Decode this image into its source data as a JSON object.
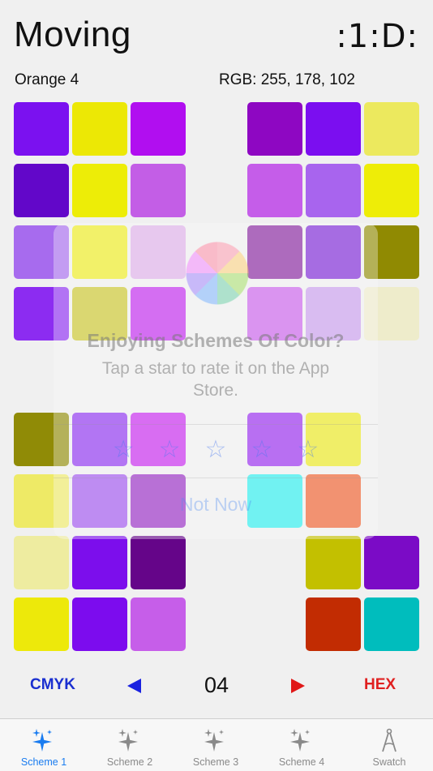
{
  "header": {
    "title": "Moving",
    "mode_badge": ":1:D:"
  },
  "selection": {
    "color_name": "Orange 4",
    "rgb": "RGB: 255, 178, 102"
  },
  "swatch_grids": [
    {
      "name": "top-left",
      "colors": [
        "#7b11f0",
        "#ece805",
        "#b10ef0",
        "#6207c9",
        "#eded07",
        "#c35ee6",
        "#a76bee",
        "#eeed1d",
        "#ddaee8",
        "#8c2cf1",
        "#c9c528",
        "#c024ef"
      ]
    },
    {
      "name": "top-right",
      "colors": [
        "#8e07c2",
        "#7b0ef0",
        "#ece95e",
        "#c55de9",
        "#a864ee",
        "#eeed07",
        "#85209d",
        "#7a21d6",
        "#908a02",
        "#c95eeb",
        "#c89ced",
        "#eeeccb"
      ]
    },
    {
      "name": "bottom-left",
      "colors": [
        "#908b06",
        "#8d2ef0",
        "#c723ee",
        "#eeea66",
        "#9f52ee",
        "#9527c3",
        "#eeeca0",
        "#7c0eec",
        "#650589",
        "#ede90a",
        "#7c0cee",
        "#c65ee9"
      ]
    },
    {
      "name": "bottom-right",
      "colors": [
        "#9525ee",
        "#ece91b",
        "",
        "#28eeee",
        "#ef5b28",
        "",
        "",
        "#c3c000",
        "#7b0bc6",
        "",
        "#c22c02",
        "#00bdbd"
      ]
    }
  ],
  "rating_dialog": {
    "title": "Enjoying Schemes Of Color?",
    "message": "Tap a star to rate it on the App Store.",
    "stars": [
      "☆",
      "☆",
      "☆",
      "☆",
      "☆"
    ],
    "dismiss_label": "Not Now"
  },
  "controls": {
    "left_mode": "CMYK",
    "right_mode": "HEX",
    "page_number": "04"
  },
  "tabs": [
    {
      "label": "Scheme 1",
      "icon": "sparkle-icon",
      "active": true
    },
    {
      "label": "Scheme 2",
      "icon": "sparkle-icon",
      "active": false
    },
    {
      "label": "Scheme 3",
      "icon": "sparkle-icon",
      "active": false
    },
    {
      "label": "Scheme 4",
      "icon": "sparkle-icon",
      "active": false
    },
    {
      "label": "Swatch",
      "icon": "compass-icon",
      "active": false
    }
  ],
  "colors": {
    "accent_blue": "#1a7cf0",
    "cmyk_blue": "#1a2fd0",
    "hex_red": "#e02020"
  }
}
